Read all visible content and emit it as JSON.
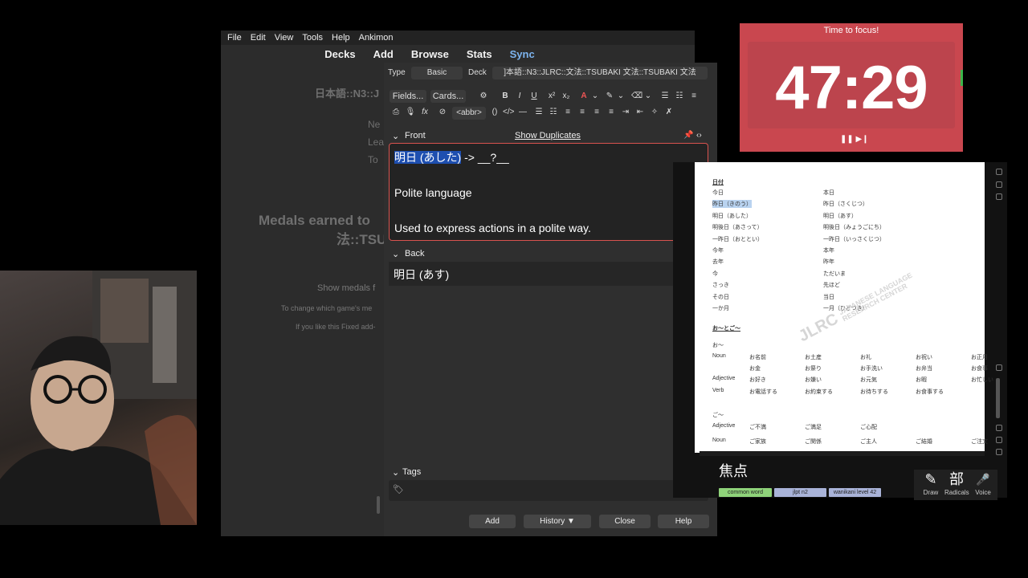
{
  "menu": [
    "File",
    "Edit",
    "View",
    "Tools",
    "Help",
    "Ankimon"
  ],
  "toolbar": {
    "decks": "Decks",
    "add": "Add",
    "browse": "Browse",
    "stats": "Stats",
    "sync": "Sync"
  },
  "overview": {
    "deck_title": "日本語::N3::J",
    "new_label": "Ne",
    "learn_label": "Lea",
    "to_label": "To",
    "medals_line1": "Medals earned to",
    "medals_line2": "法::TSU",
    "show_medals": "Show medals f",
    "change_text": "To change which game's me",
    "fixed_text": "If you like this Fixed add-"
  },
  "add_dialog": {
    "type_label": "Type",
    "type_value": "Basic",
    "deck_label": "Deck",
    "deck_value": "]本語::N3::JLRC::文法::TSUBAKI 文法::TSUBAKI 文法",
    "fields_btn": "Fields...",
    "cards_btn": "Cards...",
    "abbr": "<abbr>",
    "front_label": "Front",
    "show_duplicates": "Show Duplicates",
    "front_highlight": "明日 (あした)",
    "front_rest": " -> __?__",
    "front_line2": "Polite language",
    "front_line3": "Used to express actions in a polite way.",
    "back_label": "Back",
    "back_value": "明日 (あす)",
    "tags_label": "Tags",
    "buttons": {
      "add": "Add",
      "history": "History ▼",
      "close": "Close",
      "help": "Help"
    }
  },
  "timer": {
    "title": "Time to focus!",
    "time": "47:29",
    "controls": "❚❚ ▶❙"
  },
  "document": {
    "heading1": "日付",
    "left_col": [
      "今日",
      "昨日（きのう）",
      "明日（あした）",
      "明後日（あさって）",
      "一昨日（おととい）",
      "今年",
      "去年",
      "今",
      "さっき",
      "その日",
      "一か月"
    ],
    "right_col": [
      "本日",
      "昨日（さくじつ）",
      "明日（あす）",
      "明後日（みょうごにち）",
      "一昨日（いっさくじつ）",
      "本年",
      "昨年",
      "ただいま",
      "先ほど",
      "当日",
      "一月（ひとつき）"
    ],
    "heading2": "お～とご～",
    "o_label": "お～",
    "noun_label": "Noun",
    "adj_label": "Adjective",
    "verb_label": "Verb",
    "o_noun": [
      "お名前",
      "お土産",
      "お礼",
      "お祝い",
      "お正月"
    ],
    "o_noun2": [
      "お金",
      "お祭り",
      "お手洗い",
      "お弁当",
      "お食事"
    ],
    "o_adj": [
      "お好き",
      "お嫌い",
      "お元気",
      "お暇",
      "お忙しい"
    ],
    "o_verb": [
      "お電話する",
      "お約束する",
      "お待ちする",
      "お食事する"
    ],
    "go_label": "ご～",
    "go_adj": [
      "ご不満",
      "ご満足",
      "ご心配"
    ],
    "go_noun": [
      "ご家族",
      "ご関係",
      "ご主人",
      "ご結婚",
      "ご注文"
    ],
    "watermark": "JLRC",
    "watermark_sub1": "JAPANESE LANGUAGE",
    "watermark_sub2": "RESEARCH CENTER"
  },
  "dictionary": {
    "word": "焦点",
    "tags": [
      "common word",
      "jlpt n2",
      "wanikani level 42"
    ],
    "tag_colors": [
      "#8fd37a",
      "#a9b3d8",
      "#a9b3d8"
    ],
    "tools": [
      {
        "glyph": "✎",
        "label": "Draw"
      },
      {
        "glyph": "部",
        "label": "Radicals"
      },
      {
        "glyph": "🎤",
        "label": "Voice"
      }
    ]
  }
}
